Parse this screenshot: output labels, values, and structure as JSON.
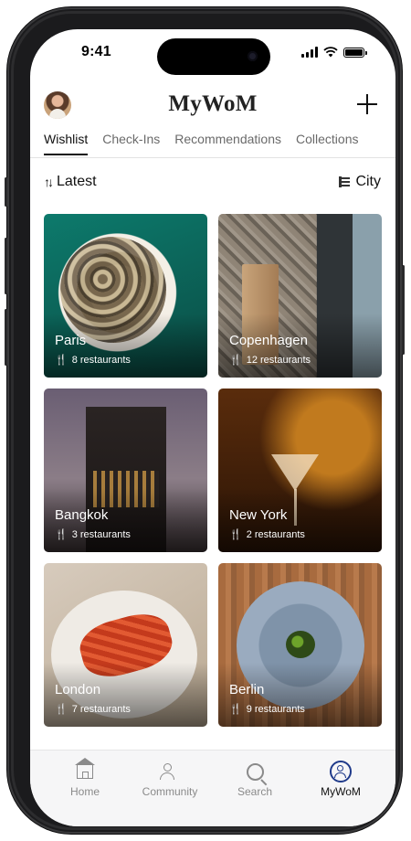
{
  "status_bar": {
    "time": "9:41"
  },
  "header": {
    "app_title": "MyWoM"
  },
  "tabs": [
    {
      "label": "Wishlist",
      "active": true
    },
    {
      "label": "Check-Ins",
      "active": false
    },
    {
      "label": "Recommendations",
      "active": false
    },
    {
      "label": "Collections",
      "active": false
    }
  ],
  "sort": {
    "label": "Latest",
    "icon": "sort-arrows-icon"
  },
  "group_by": {
    "label": "City",
    "icon": "list-icon"
  },
  "cities": [
    {
      "name": "Paris",
      "count": "8 restaurants"
    },
    {
      "name": "Copenhagen",
      "count": "12 restaurants"
    },
    {
      "name": "Bangkok",
      "count": "3 restaurants"
    },
    {
      "name": "New York",
      "count": "2 restaurants"
    },
    {
      "name": "London",
      "count": "7 restaurants"
    },
    {
      "name": "Berlin",
      "count": "9 restaurants"
    }
  ],
  "nav": [
    {
      "label": "Home",
      "icon": "home-icon",
      "active": false
    },
    {
      "label": "Community",
      "icon": "community-icon",
      "active": false
    },
    {
      "label": "Search",
      "icon": "search-icon",
      "active": false
    },
    {
      "label": "MyWoM",
      "icon": "profile-icon",
      "active": true
    }
  ],
  "colors": {
    "accent": "#1f3a8a",
    "text": "#111111",
    "muted": "#8a8a8a"
  }
}
